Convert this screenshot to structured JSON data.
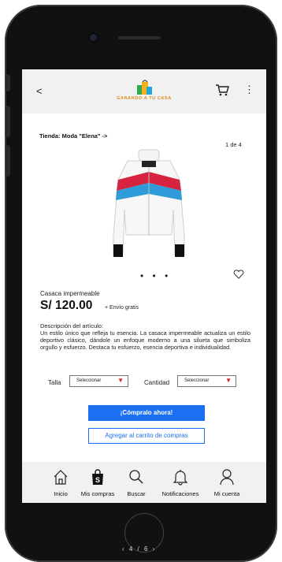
{
  "header": {
    "back_label": "<",
    "logo_text": "GANANDO A TU CASA",
    "menu_label": "⋮"
  },
  "store": {
    "label": "Tienda: Moda \"Elena\"   ->",
    "image_counter": "1 de 4",
    "carousel_dots": "• • •"
  },
  "product": {
    "name": "Casaca impermeable",
    "price": "S/ 120.00",
    "shipping": "+ Envío gratis",
    "description_title": "Descripción del artículo:",
    "description": "Un estilo único que refleja tu esencia. La casaca impermeable actualiza un estilo deportivo clásico, dándole un enfoque moderno a una silueta que simboliza orgullo y esfuerzo. Destaca tu esfuerzo, esencia deportiva e individualidad."
  },
  "options": {
    "size_label": "Talla",
    "size_value": "Seleccionar",
    "qty_label": "Cantidad",
    "qty_value": "Seleccionar"
  },
  "actions": {
    "buy_label": "¡Cómpralo ahora!",
    "add_cart_label": "Agregar al carrito de compras"
  },
  "nav": {
    "items": [
      {
        "label": "Inicio",
        "icon": "home-icon"
      },
      {
        "label": "Mis compras",
        "icon": "shopping-bag-icon"
      },
      {
        "label": "Buscar",
        "icon": "search-icon"
      },
      {
        "label": "Notificaciones",
        "icon": "bell-icon"
      },
      {
        "label": "Mi cuenta",
        "icon": "user-icon"
      }
    ]
  },
  "device": {
    "pager_text": "‹  4 / 6  ›"
  },
  "colors": {
    "primary": "#1a6ff2",
    "caret": "#d0202a",
    "bar": "#f1f1f1",
    "logo": "#e08a1e"
  }
}
